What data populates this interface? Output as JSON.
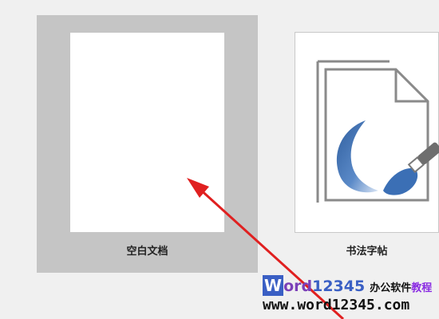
{
  "templates": [
    {
      "label": "空白文档",
      "icon": "blank-page-icon",
      "selected": true
    },
    {
      "label": "书法字帖",
      "icon": "calligraphy-brush-icon",
      "selected": false
    }
  ],
  "watermark": {
    "brand_w": "W",
    "brand_ord": "ord",
    "brand_digits": "12345",
    "tagline": "办公软件",
    "tagline_accent": "教程",
    "url": "www.word12345.com"
  },
  "colors": {
    "selection_bg": "#c5c5c5",
    "pointer_arrow": "#e02020",
    "brush_blue": "#3b6fb5"
  }
}
